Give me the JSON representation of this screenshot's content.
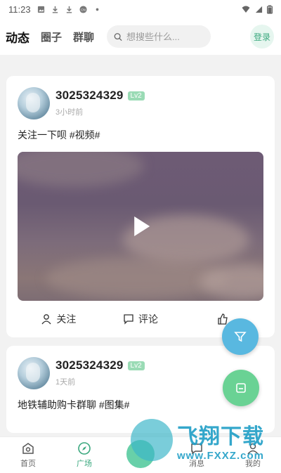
{
  "status_bar": {
    "time": "11:23",
    "icons": [
      "photo-icon",
      "download-icon",
      "download-icon",
      "cn-icon",
      "dot-icon",
      "wifi-icon",
      "signal-icon",
      "battery-icon"
    ]
  },
  "header": {
    "tabs": [
      {
        "label": "动态",
        "active": true
      },
      {
        "label": "圈子",
        "active": false
      },
      {
        "label": "群聊",
        "active": false
      }
    ],
    "search": {
      "placeholder": "想搜些什么..."
    },
    "login_label": "登录"
  },
  "posts": [
    {
      "username": "3025324329",
      "level": "Lv2",
      "time": "3小时前",
      "text": "关注一下呗 #视频#",
      "has_video": true,
      "actions": {
        "follow": "关注",
        "comment": "评论"
      }
    },
    {
      "username": "3025324329",
      "level": "Lv2",
      "time": "1天前",
      "text": "地铁辅助购卡群聊 #图集#"
    }
  ],
  "bottom_nav": [
    {
      "label": "首页",
      "icon": "home-icon",
      "active": false
    },
    {
      "label": "广场",
      "icon": "compass-icon",
      "active": true
    },
    {
      "label": "",
      "icon": "plus-icon",
      "active": false
    },
    {
      "label": "消息",
      "icon": "message-icon",
      "active": false
    },
    {
      "label": "我的",
      "icon": "user-icon",
      "active": false
    }
  ],
  "watermark": {
    "title": "飞翔下载",
    "url": "www.FXXZ.com"
  },
  "colors": {
    "accent": "#4dc89a",
    "filter_fab": "#59b8e0",
    "post_fab": "#6ad294",
    "level_badge": "#9adbb5"
  }
}
